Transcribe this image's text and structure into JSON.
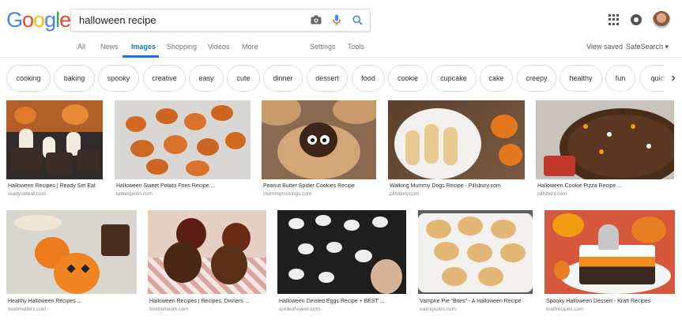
{
  "logo": {
    "letters": [
      "G",
      "o",
      "o",
      "g",
      "l",
      "e"
    ],
    "colors": [
      "#4285f4",
      "#ea4335",
      "#fbbc05",
      "#4285f4",
      "#34a853",
      "#ea4335"
    ]
  },
  "search": {
    "query": "halloween recipe",
    "icons": [
      "camera-icon",
      "microphone-icon",
      "search-icon"
    ]
  },
  "header_right": {
    "icons": [
      "apps-grid-icon",
      "notifications-icon",
      "account-avatar"
    ]
  },
  "tabs": [
    "All",
    "News",
    "Images",
    "Shopping",
    "Videos",
    "More",
    "Settings",
    "Tools"
  ],
  "active_tab": "Images",
  "tools_right": {
    "view_saved": "View saved",
    "safesearch": "SafeSearch ▾"
  },
  "chips": [
    "cooking",
    "baking",
    "spooky",
    "creative",
    "easy",
    "cute",
    "dinner",
    "dessert",
    "food",
    "cookie",
    "cupcake",
    "cake",
    "creepy",
    "healthy",
    "fun",
    "quick"
  ],
  "chips_next_glyph": "›",
  "results": [
    {
      "caption": "Halloween Recipes | Ready Set Eat",
      "source": "readyseteat.com"
    },
    {
      "caption": "Halloween Sweet Potato Fries Recipe ...",
      "source": "tablespoon.com"
    },
    {
      "caption": "Peanut Butter Spider Cookies Recipe",
      "source": "mommymusings.com"
    },
    {
      "caption": "Walking Mummy Dogs Recipe - Pillsbury.com",
      "source": "pillsbury.com"
    },
    {
      "caption": "Halloween Cookie Pizza Recipe ...",
      "source": "pillsbury.com"
    },
    {
      "caption": "Healthy Halloween Recipes ...",
      "source": "foodmatters.com"
    },
    {
      "caption": "Halloween Recipes | Recipes, Dinners ...",
      "source": "foodnetwork.com"
    },
    {
      "caption": "Halloween Deviled Eggs Recipe + BEST ...",
      "source": "asideofsweet.com"
    },
    {
      "caption": "Vampire Pie \"Bites\" - A Halloween Recipe",
      "source": "eatingrules.com"
    },
    {
      "caption": "Spooky Halloween Dessert - Kraft Recipes",
      "source": "kraftrecipes.com"
    }
  ]
}
